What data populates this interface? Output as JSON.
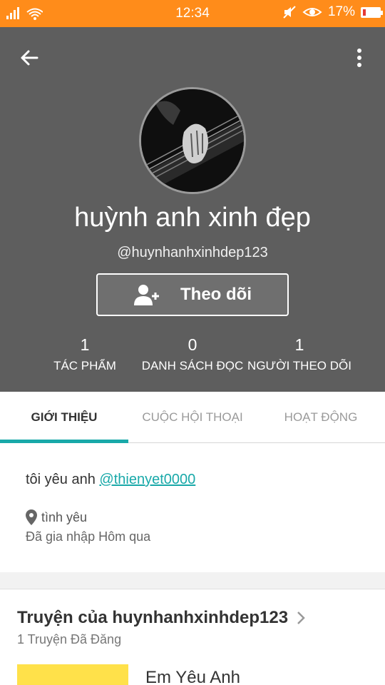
{
  "status_bar": {
    "time": "12:34",
    "battery_percent": "17%",
    "battery_level": 0.17,
    "icons": [
      "signal-icon",
      "wifi-icon",
      "mute-icon",
      "eye-icon",
      "battery-icon"
    ]
  },
  "profile": {
    "display_name": "huỳnh anh xinh đẹp",
    "username": "@huynhanhxinhdep123",
    "follow_button": "Theo dõi",
    "stats": [
      {
        "value": "1",
        "label": "TÁC PHẨM"
      },
      {
        "value": "0",
        "label": "DANH SÁCH ĐỌC"
      },
      {
        "value": "1",
        "label": "NGƯỜI THEO DÕI"
      }
    ]
  },
  "tabs": [
    {
      "label": "GIỚI THIỆU",
      "active": true
    },
    {
      "label": "CUỘC HỘI THOẠI",
      "active": false
    },
    {
      "label": "HOẠT ĐỘNG",
      "active": false
    }
  ],
  "about": {
    "bio_text": "tôi yêu anh ",
    "bio_mention": "@thienyet0000",
    "location": "tình yêu",
    "joined": "Đã gia nhập Hôm qua"
  },
  "stories": {
    "title": "Truyện của huynhanhxinhdep123",
    "count": "1 Truyện Đã Đăng",
    "items": [
      {
        "title": "Em Yêu Anh"
      }
    ]
  },
  "colors": {
    "status_bar": "#ff8c1a",
    "header_bg": "#5e5e5e",
    "accent": "#19a9a9",
    "cover": "#ffe14a"
  }
}
